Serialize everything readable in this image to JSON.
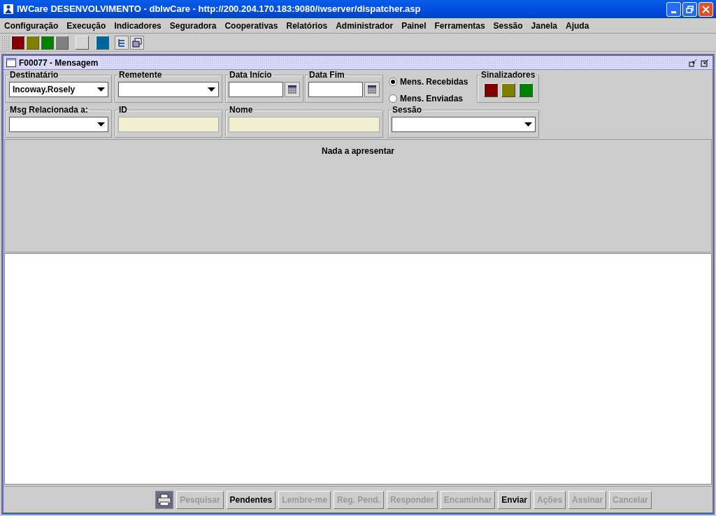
{
  "window": {
    "title": "IWCare DESENVOLVIMENTO - dbIwCare - http://200.204.170.183:9080/iwserver/dispatcher.asp"
  },
  "menu": [
    "Configuração",
    "Execução",
    "Indicadores",
    "Seguradora",
    "Cooperativas",
    "Relatórios",
    "Administrador",
    "Painel",
    "Ferramentas",
    "Sessão",
    "Janela",
    "Ajuda"
  ],
  "toolbar": {
    "swatches": [
      {
        "color": "#800000"
      },
      {
        "color": "#808000"
      },
      {
        "color": "#008000"
      },
      {
        "color": "#808080"
      },
      {
        "color": "#d4d4d4"
      },
      {
        "color": "#006699"
      }
    ]
  },
  "frame": {
    "title": "F00077 - Mensagem"
  },
  "filters": {
    "destinatario": {
      "label": "Destinatário",
      "value": "Incoway.Rosely"
    },
    "remetente": {
      "label": "Remetente"
    },
    "data_inicio": {
      "label": "Data Início"
    },
    "data_fim": {
      "label": "Data Fim"
    },
    "message_types": [
      {
        "label": "Mens. Recebidas",
        "selected": true
      },
      {
        "label": "Mens. Enviadas",
        "selected": false
      }
    ],
    "sinalizadores": {
      "label": "Sinalizadores",
      "flags": [
        {
          "color": "#800000"
        },
        {
          "color": "#808000"
        },
        {
          "color": "#008000"
        }
      ]
    },
    "msg_relacionada": {
      "label": "Msg Relacionada a:"
    },
    "id": {
      "label": "ID"
    },
    "nome": {
      "label": "Nome"
    },
    "sessao": {
      "label": "Sessão"
    }
  },
  "results": {
    "message": "Nada a apresentar"
  },
  "buttons": [
    {
      "label": "Pesquisar",
      "disabled": true
    },
    {
      "label": "Pendentes",
      "disabled": false
    },
    {
      "label": "Lembre-me",
      "disabled": true
    },
    {
      "label": "Reg. Pend.",
      "disabled": true
    },
    {
      "label": "Responder",
      "disabled": true
    },
    {
      "label": "Encaminhar",
      "disabled": true
    },
    {
      "label": "Enviar",
      "disabled": false
    },
    {
      "label": "Ações",
      "disabled": true
    },
    {
      "label": "Assinar",
      "disabled": true
    },
    {
      "label": "Cancelar",
      "disabled": true
    }
  ]
}
